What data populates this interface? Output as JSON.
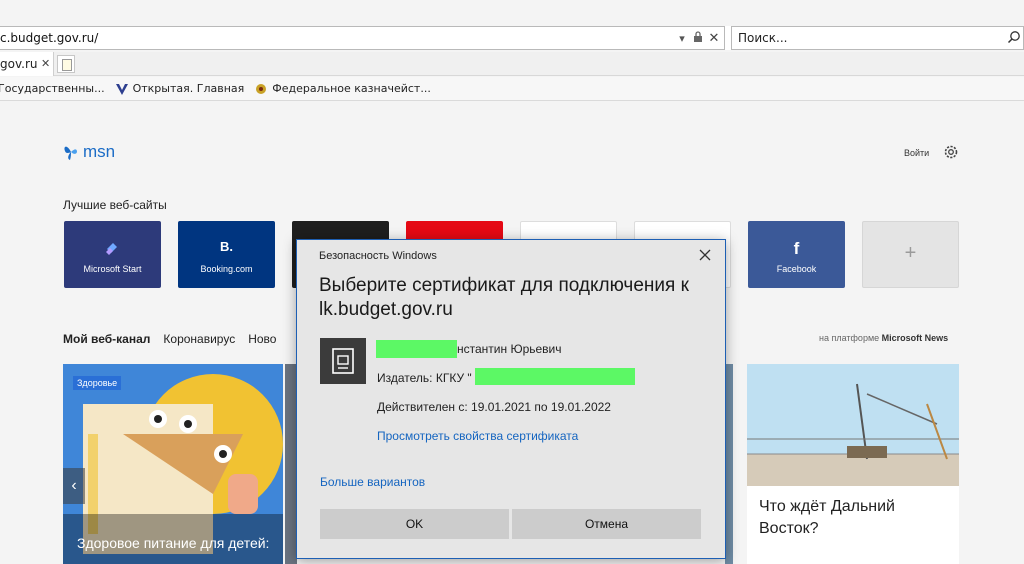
{
  "browser": {
    "address": "c.budget.gov.ru/",
    "search_placeholder": "Поиск...",
    "tab_label": "gov.ru",
    "favorites": [
      {
        "label": "Государственны..."
      },
      {
        "label": "Открытая. Главная"
      },
      {
        "label": "Федеральное казначейст..."
      }
    ]
  },
  "msn": {
    "logo": "msn",
    "signin": "Войти",
    "sites_heading": "Лучшие веб-сайты",
    "tiles": [
      {
        "label": "Microsoft Start",
        "icon": "",
        "color": "#2d3a7a"
      },
      {
        "label": "Booking.com",
        "icon": "B.",
        "color": "#003580"
      },
      {
        "label": "",
        "icon": "",
        "color": "#1e1e1e"
      },
      {
        "label": "",
        "icon": "",
        "color": "#e50914"
      },
      {
        "label": "",
        "icon": "",
        "color": "#ffffff"
      },
      {
        "label": "",
        "icon": "",
        "color": "#ffffff"
      },
      {
        "label": "Facebook",
        "icon": "f",
        "color": "#3b5998"
      },
      {
        "label": "",
        "icon": "+",
        "color": "#e4e4e4"
      }
    ],
    "feed_tabs": [
      "Мой веб-канал",
      "Коронавирус",
      "Ново"
    ],
    "platform_prefix": "на платформе",
    "platform_name": "Microsoft News",
    "cards": [
      {
        "badge": "Здоровье",
        "title": "Здоровое питание для детей:"
      },
      {
        "title": "Что ждёт Дальний Восток?"
      }
    ]
  },
  "dialog": {
    "caption": "Безопасность Windows",
    "title": "Выберите сертификат для подключения к lk.budget.gov.ru",
    "cert_name_suffix": "нстантин Юрьевич",
    "issuer_prefix": "Издатель: КГКУ \"",
    "valid": "Действителен с: 19.01.2021 по 19.01.2022",
    "view_link": "Просмотреть свойства сертификата",
    "more": "Больше вариантов",
    "ok": "OK",
    "cancel": "Отмена",
    "redact_color": "#5cf865"
  }
}
